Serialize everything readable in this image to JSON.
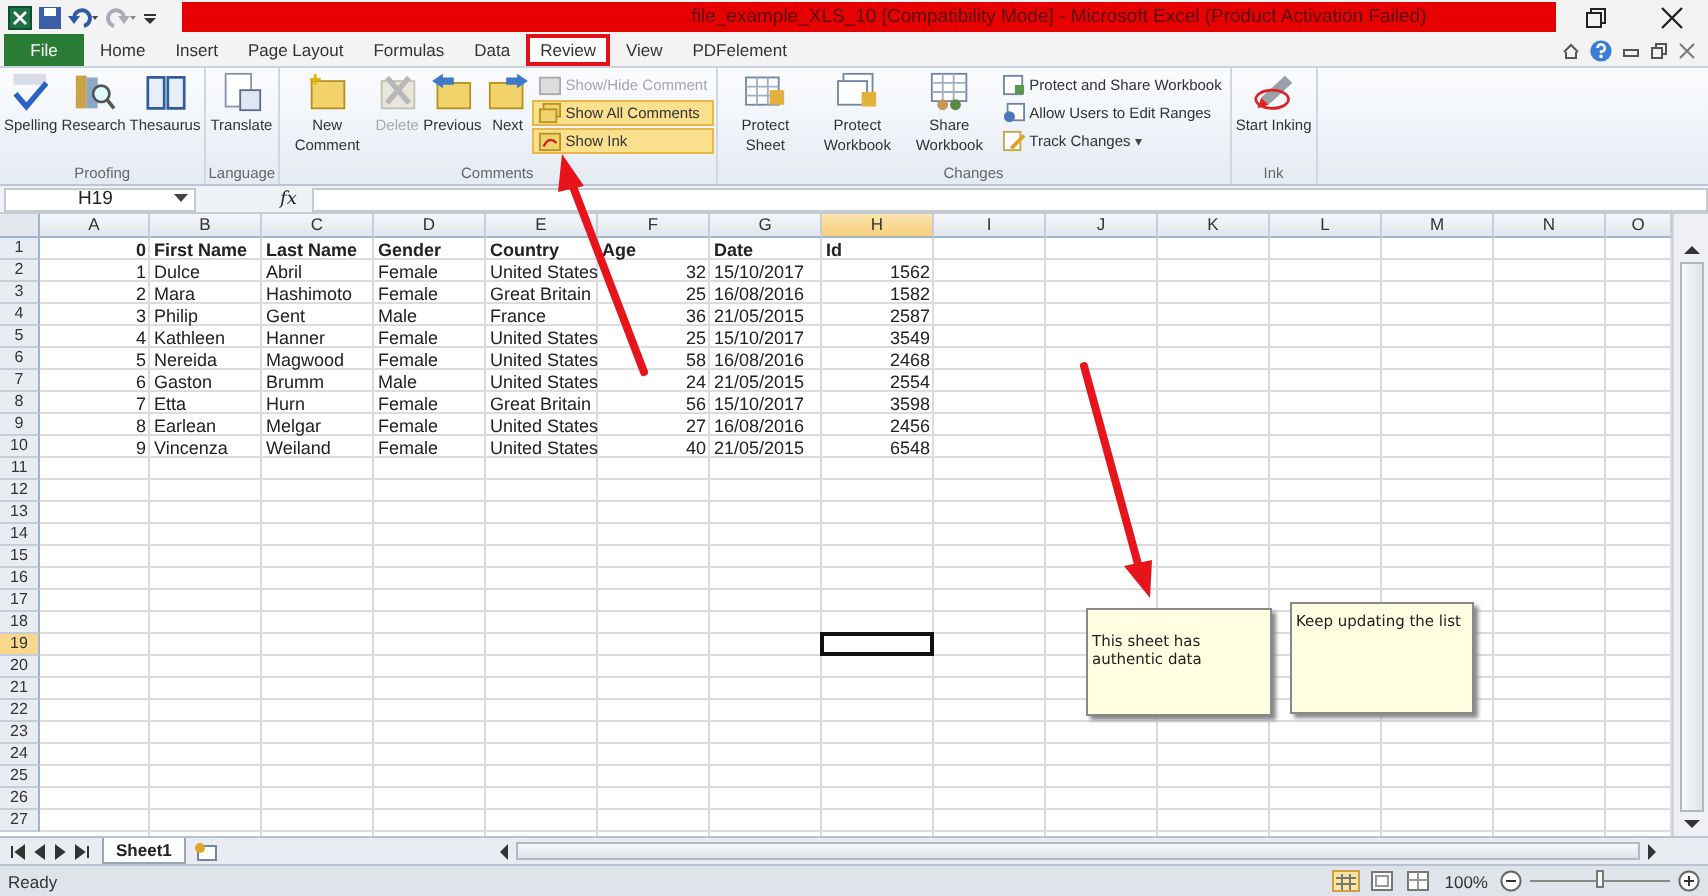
{
  "window": {
    "title": "file_example_XLS_10  [Compatibility Mode]  -  Microsoft Excel (Product Activation Failed)"
  },
  "tabs": [
    {
      "label": "File",
      "kind": "file",
      "selected": false,
      "highlighted": false
    },
    {
      "label": "Home",
      "kind": "tab",
      "selected": false,
      "highlighted": false
    },
    {
      "label": "Insert",
      "kind": "tab",
      "selected": false,
      "highlighted": false
    },
    {
      "label": "Page Layout",
      "kind": "tab",
      "selected": false,
      "highlighted": false
    },
    {
      "label": "Formulas",
      "kind": "tab",
      "selected": false,
      "highlighted": false
    },
    {
      "label": "Data",
      "kind": "tab",
      "selected": false,
      "highlighted": false
    },
    {
      "label": "Review",
      "kind": "tab",
      "selected": true,
      "highlighted": true
    },
    {
      "label": "View",
      "kind": "tab",
      "selected": false,
      "highlighted": false
    },
    {
      "label": "PDFelement",
      "kind": "tab",
      "selected": false,
      "highlighted": false
    }
  ],
  "ribbon": {
    "groups": [
      {
        "label": "Proofing",
        "buttons": [
          {
            "label": "Spelling",
            "kind": "large",
            "disabled": false,
            "on": false
          },
          {
            "label": "Research",
            "kind": "large",
            "disabled": false,
            "on": false
          },
          {
            "label": "Thesaurus",
            "kind": "large",
            "disabled": false,
            "on": false
          }
        ]
      },
      {
        "label": "Language",
        "buttons": [
          {
            "label": "Translate",
            "kind": "large",
            "disabled": false,
            "on": false
          }
        ]
      },
      {
        "label": "Comments",
        "buttons": [
          {
            "label": "New Comment",
            "kind": "large",
            "disabled": false,
            "on": false
          },
          {
            "label": "Delete",
            "kind": "large",
            "disabled": true,
            "on": false
          },
          {
            "label": "Previous",
            "kind": "large",
            "disabled": false,
            "on": false
          },
          {
            "label": "Next",
            "kind": "large",
            "disabled": false,
            "on": false
          },
          {
            "label": "Show/Hide Comment",
            "kind": "small",
            "disabled": true,
            "on": false
          },
          {
            "label": "Show All Comments",
            "kind": "small",
            "disabled": false,
            "on": true
          },
          {
            "label": "Show Ink",
            "kind": "small",
            "disabled": false,
            "on": true
          }
        ]
      },
      {
        "label": "Changes",
        "buttons": [
          {
            "label": "Protect Sheet",
            "kind": "large",
            "disabled": false,
            "on": false
          },
          {
            "label": "Protect Workbook",
            "kind": "large",
            "disabled": false,
            "on": false
          },
          {
            "label": "Share Workbook",
            "kind": "large",
            "disabled": false,
            "on": false
          },
          {
            "label": "Protect and Share Workbook",
            "kind": "small",
            "disabled": false,
            "on": false
          },
          {
            "label": "Allow Users to Edit Ranges",
            "kind": "small",
            "disabled": false,
            "on": false
          },
          {
            "label": "Track Changes",
            "kind": "small",
            "disabled": false,
            "on": false,
            "caret": "▾"
          }
        ]
      },
      {
        "label": "Ink",
        "buttons": [
          {
            "label": "Start Inking",
            "kind": "large",
            "disabled": false,
            "on": false
          }
        ]
      }
    ]
  },
  "formula_bar": {
    "name_box": "H19",
    "fx": "fx"
  },
  "sheet": {
    "columns": [
      {
        "label": "A",
        "selected": false
      },
      {
        "label": "B",
        "selected": false
      },
      {
        "label": "C",
        "selected": false
      },
      {
        "label": "D",
        "selected": false
      },
      {
        "label": "E",
        "selected": false
      },
      {
        "label": "F",
        "selected": false
      },
      {
        "label": "G",
        "selected": false
      },
      {
        "label": "H",
        "selected": true
      },
      {
        "label": "I",
        "selected": false
      },
      {
        "label": "J",
        "selected": false
      },
      {
        "label": "K",
        "selected": false
      },
      {
        "label": "L",
        "selected": false
      },
      {
        "label": "M",
        "selected": false
      },
      {
        "label": "N",
        "selected": false
      },
      {
        "label": "O",
        "selected": false
      }
    ],
    "rows": [
      {
        "label": "1",
        "selected": false,
        "bold": true,
        "cells": [
          {
            "text": "0",
            "kind": "number"
          },
          {
            "text": "First Name",
            "kind": "text"
          },
          {
            "text": "Last Name",
            "kind": "text"
          },
          {
            "text": "Gender",
            "kind": "text"
          },
          {
            "text": "Country",
            "kind": "text"
          },
          {
            "text": "Age",
            "kind": "text"
          },
          {
            "text": "Date",
            "kind": "text"
          },
          {
            "text": "Id",
            "kind": "text"
          }
        ]
      },
      {
        "label": "2",
        "selected": false,
        "bold": false,
        "cells": [
          {
            "text": "1",
            "kind": "number"
          },
          {
            "text": "Dulce",
            "kind": "text"
          },
          {
            "text": "Abril",
            "kind": "text"
          },
          {
            "text": "Female",
            "kind": "text"
          },
          {
            "text": "United States",
            "kind": "text"
          },
          {
            "text": "32",
            "kind": "number"
          },
          {
            "text": "15/10/2017",
            "kind": "text"
          },
          {
            "text": "1562",
            "kind": "number"
          }
        ]
      },
      {
        "label": "3",
        "selected": false,
        "bold": false,
        "cells": [
          {
            "text": "2",
            "kind": "number"
          },
          {
            "text": "Mara",
            "kind": "text"
          },
          {
            "text": "Hashimoto",
            "kind": "text"
          },
          {
            "text": "Female",
            "kind": "text"
          },
          {
            "text": "Great Britain",
            "kind": "text"
          },
          {
            "text": "25",
            "kind": "number"
          },
          {
            "text": "16/08/2016",
            "kind": "text"
          },
          {
            "text": "1582",
            "kind": "number"
          }
        ]
      },
      {
        "label": "4",
        "selected": false,
        "bold": false,
        "cells": [
          {
            "text": "3",
            "kind": "number"
          },
          {
            "text": "Philip",
            "kind": "text"
          },
          {
            "text": "Gent",
            "kind": "text"
          },
          {
            "text": "Male",
            "kind": "text"
          },
          {
            "text": "France",
            "kind": "text"
          },
          {
            "text": "36",
            "kind": "number"
          },
          {
            "text": "21/05/2015",
            "kind": "text"
          },
          {
            "text": "2587",
            "kind": "number"
          }
        ]
      },
      {
        "label": "5",
        "selected": false,
        "bold": false,
        "cells": [
          {
            "text": "4",
            "kind": "number"
          },
          {
            "text": "Kathleen",
            "kind": "text"
          },
          {
            "text": "Hanner",
            "kind": "text"
          },
          {
            "text": "Female",
            "kind": "text"
          },
          {
            "text": "United States",
            "kind": "text"
          },
          {
            "text": "25",
            "kind": "number"
          },
          {
            "text": "15/10/2017",
            "kind": "text"
          },
          {
            "text": "3549",
            "kind": "number"
          }
        ]
      },
      {
        "label": "6",
        "selected": false,
        "bold": false,
        "cells": [
          {
            "text": "5",
            "kind": "number"
          },
          {
            "text": "Nereida",
            "kind": "text"
          },
          {
            "text": "Magwood",
            "kind": "text"
          },
          {
            "text": "Female",
            "kind": "text"
          },
          {
            "text": "United States",
            "kind": "text"
          },
          {
            "text": "58",
            "kind": "number"
          },
          {
            "text": "16/08/2016",
            "kind": "text"
          },
          {
            "text": "2468",
            "kind": "number"
          }
        ]
      },
      {
        "label": "7",
        "selected": false,
        "bold": false,
        "cells": [
          {
            "text": "6",
            "kind": "number"
          },
          {
            "text": "Gaston",
            "kind": "text"
          },
          {
            "text": "Brumm",
            "kind": "text"
          },
          {
            "text": "Male",
            "kind": "text"
          },
          {
            "text": "United States",
            "kind": "text"
          },
          {
            "text": "24",
            "kind": "number"
          },
          {
            "text": "21/05/2015",
            "kind": "text"
          },
          {
            "text": "2554",
            "kind": "number"
          }
        ]
      },
      {
        "label": "8",
        "selected": false,
        "bold": false,
        "cells": [
          {
            "text": "7",
            "kind": "number"
          },
          {
            "text": "Etta",
            "kind": "text"
          },
          {
            "text": "Hurn",
            "kind": "text"
          },
          {
            "text": "Female",
            "kind": "text"
          },
          {
            "text": "Great Britain",
            "kind": "text"
          },
          {
            "text": "56",
            "kind": "number"
          },
          {
            "text": "15/10/2017",
            "kind": "text"
          },
          {
            "text": "3598",
            "kind": "number"
          }
        ]
      },
      {
        "label": "9",
        "selected": false,
        "bold": false,
        "cells": [
          {
            "text": "8",
            "kind": "number"
          },
          {
            "text": "Earlean",
            "kind": "text"
          },
          {
            "text": "Melgar",
            "kind": "text"
          },
          {
            "text": "Female",
            "kind": "text"
          },
          {
            "text": "United States",
            "kind": "text"
          },
          {
            "text": "27",
            "kind": "number"
          },
          {
            "text": "16/08/2016",
            "kind": "text"
          },
          {
            "text": "2456",
            "kind": "number"
          }
        ]
      },
      {
        "label": "10",
        "selected": false,
        "bold": false,
        "cells": [
          {
            "text": "9",
            "kind": "number"
          },
          {
            "text": "Vincenza",
            "kind": "text"
          },
          {
            "text": "Weiland",
            "kind": "text"
          },
          {
            "text": "Female",
            "kind": "text"
          },
          {
            "text": "United States",
            "kind": "text"
          },
          {
            "text": "40",
            "kind": "number"
          },
          {
            "text": "21/05/2015",
            "kind": "text"
          },
          {
            "text": "6548",
            "kind": "number"
          }
        ]
      },
      {
        "label": "11",
        "selected": false
      },
      {
        "label": "12",
        "selected": false
      },
      {
        "label": "13",
        "selected": false
      },
      {
        "label": "14",
        "selected": false
      },
      {
        "label": "15",
        "selected": false
      },
      {
        "label": "16",
        "selected": false
      },
      {
        "label": "17",
        "selected": false
      },
      {
        "label": "18",
        "selected": false
      },
      {
        "label": "19",
        "selected": true
      },
      {
        "label": "20",
        "selected": false
      },
      {
        "label": "21",
        "selected": false
      },
      {
        "label": "22",
        "selected": false
      },
      {
        "label": "23",
        "selected": false
      },
      {
        "label": "24",
        "selected": false
      },
      {
        "label": "25",
        "selected": false
      },
      {
        "label": "26",
        "selected": false
      },
      {
        "label": "27",
        "selected": false
      }
    ],
    "comments": [
      {
        "text": "This sheet has authentic data"
      },
      {
        "text": "Keep updating the list"
      }
    ]
  },
  "sheet_tabs": [
    {
      "label": "Sheet1",
      "selected": true
    }
  ],
  "status_bar": {
    "status": "Ready",
    "zoom": "100%",
    "zoom_slider": {
      "level": 0.5
    }
  }
}
